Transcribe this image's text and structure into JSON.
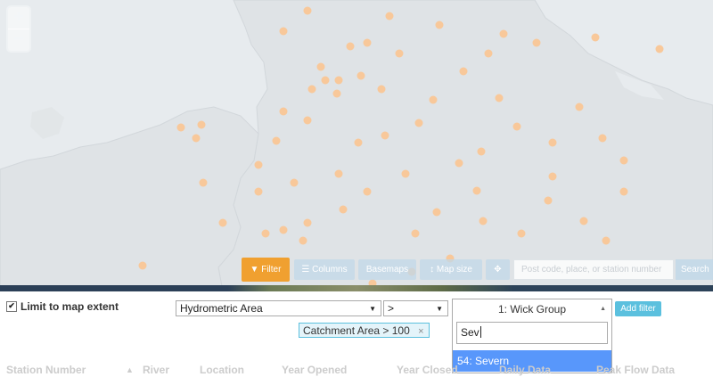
{
  "map": {
    "zoom_in": "+",
    "zoom_out": "−",
    "toolbar": {
      "filter_label": "Filter",
      "columns_label": "Columns",
      "basemaps_label": "Basemaps",
      "mapsize_label": "Map size",
      "locate_label": "✥",
      "search_placeholder": "Post code, place, or station number",
      "search_label": "Search"
    }
  },
  "filter": {
    "limit_label": "Limit to map extent",
    "limit_checked": "✔",
    "field_select": "Hydrometric Area",
    "operator_select": ">",
    "value_combo": "1: Wick Group",
    "add_filter_label": "Add filter",
    "dropdown_search_value": "Sev",
    "dropdown_option": "54: Severn",
    "active_filter": "Catchment Area > 100",
    "active_filter_remove": "×"
  },
  "table": {
    "columns": [
      "Station Number",
      "River",
      "Location",
      "Year Opened",
      "Year Closed",
      "Daily Data",
      "Peak Flow Data"
    ]
  },
  "colors": {
    "accent_orange": "#f0a030",
    "info_blue": "#5bc0de",
    "highlight_blue": "#5897fb"
  }
}
